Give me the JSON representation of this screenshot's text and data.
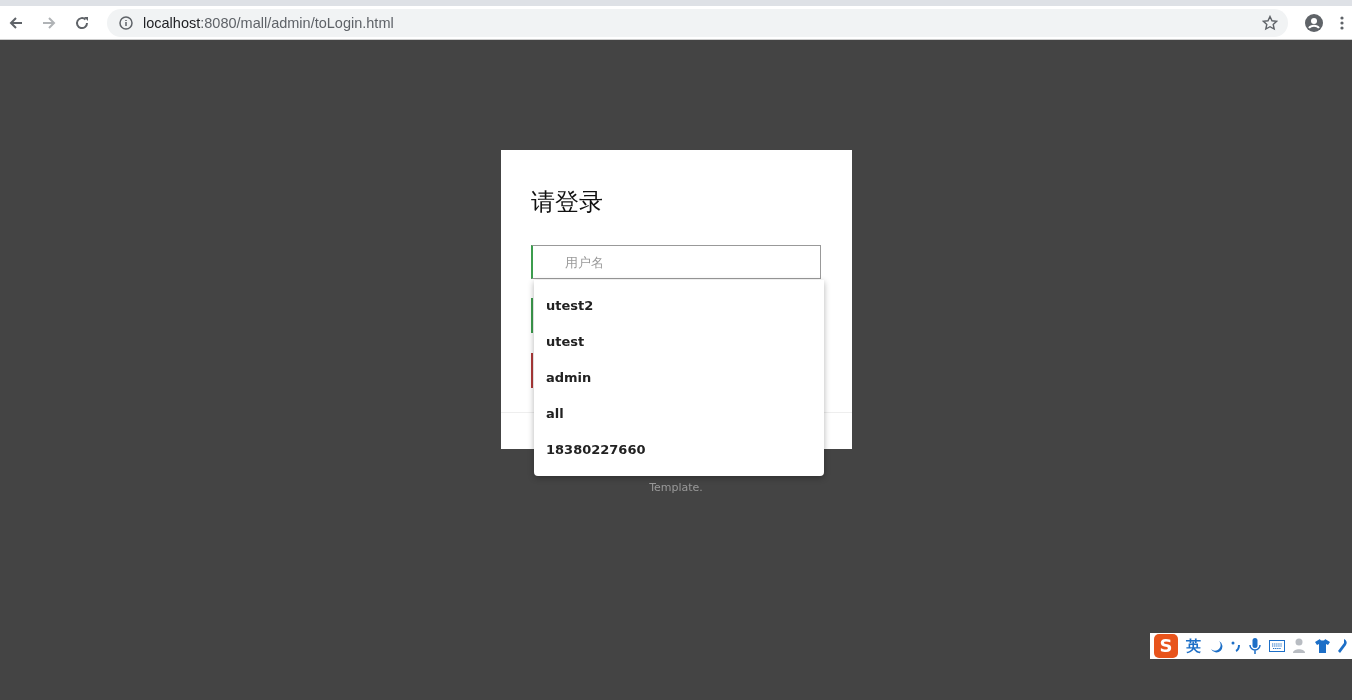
{
  "browser": {
    "url_host": "localhost",
    "url_path": ":8080/mall/admin/toLogin.html"
  },
  "login": {
    "title": "请登录",
    "username": {
      "placeholder": "用户名",
      "focused": true
    },
    "hidden_fields": [
      {
        "color": "#3c9d4e"
      },
      {
        "color": "#b03a3a"
      }
    ],
    "suggestions": [
      "utest2",
      "utest",
      "admin",
      "all",
      "18380227660"
    ]
  },
  "footer": {
    "text": "Template."
  },
  "ime_bar": {
    "logo": "S",
    "mode": "英"
  }
}
